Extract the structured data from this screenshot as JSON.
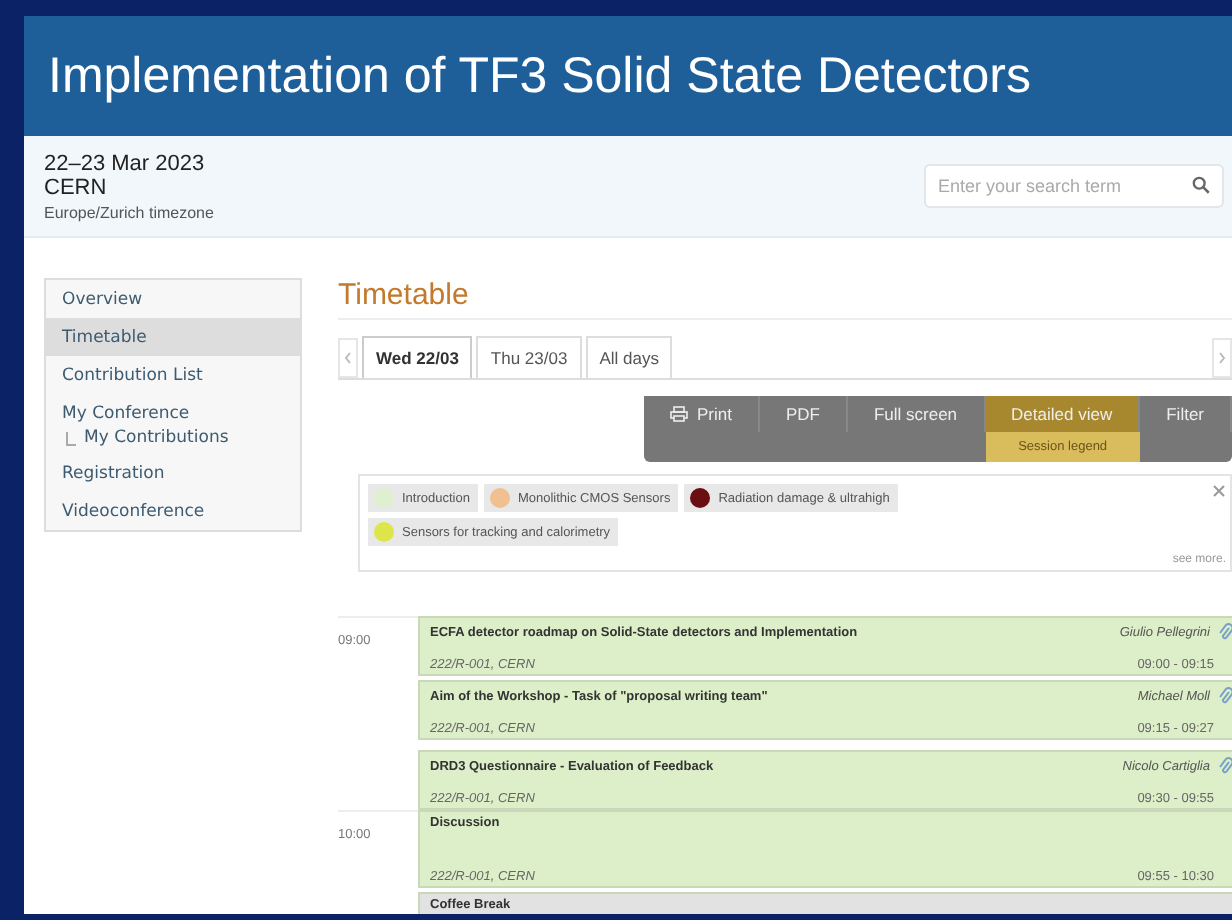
{
  "header": {
    "title": "Implementation of TF3 Solid State Detectors"
  },
  "event_info": {
    "dates": "22–23 Mar 2023",
    "venue": "CERN",
    "timezone": "Europe/Zurich timezone"
  },
  "search": {
    "placeholder": "Enter your search term"
  },
  "sidebar": {
    "items": [
      {
        "label": "Overview",
        "selected": false
      },
      {
        "label": "Timetable",
        "selected": true
      },
      {
        "label": "Contribution List",
        "selected": false
      },
      {
        "label": "My Conference",
        "selected": false,
        "children": [
          {
            "label": "My Contributions"
          }
        ]
      },
      {
        "label": "Registration",
        "selected": false
      },
      {
        "label": "Videoconference",
        "selected": false
      }
    ]
  },
  "page_title": "Timetable",
  "day_tabs": [
    {
      "label": "Wed 22/03",
      "selected": true
    },
    {
      "label": "Thu 23/03",
      "selected": false
    },
    {
      "label": "All days",
      "selected": false
    }
  ],
  "toolbar": [
    {
      "label": "Print",
      "kind": "print",
      "selected": false
    },
    {
      "label": "PDF",
      "kind": "plain",
      "selected": false
    },
    {
      "label": "Full screen",
      "kind": "plain",
      "selected": false
    },
    {
      "label": "Detailed view",
      "kind": "plain",
      "selected": true
    },
    {
      "label": "Filter",
      "kind": "plain",
      "selected": false
    }
  ],
  "dropdown_item": "Session legend",
  "legend": {
    "items": [
      {
        "label": "Introduction",
        "color": "#dff0d0"
      },
      {
        "label": "Monolithic CMOS Sensors",
        "color": "#f0c090"
      },
      {
        "label": "Radiation damage & ultrahigh",
        "color": "#6a0f12"
      },
      {
        "label": "Sensors for tracking and calorimetry",
        "color": "#dde54a"
      }
    ],
    "see_more": "see more."
  },
  "slots": [
    {
      "time": "09:00",
      "entries": [
        {
          "title": "ECFA detector roadmap on Solid-State detectors and Implementation",
          "speaker": "Giulio Pellegrini",
          "location": "222/R-001, CERN",
          "range": "09:00 - 09:15",
          "attachment": true,
          "color": "#dcefc8"
        },
        {
          "title": "Aim of the Workshop - Task of \"proposal writing team\"",
          "speaker": "Michael Moll",
          "location": "222/R-001, CERN",
          "range": "09:15 - 09:27",
          "attachment": true,
          "color": "#dcefc8"
        },
        {
          "title": "DRD3 Questionnaire - Evaluation of Feedback",
          "speaker": "Nicolo Cartiglia",
          "location": "222/R-001, CERN",
          "range": "09:30 - 09:55",
          "attachment": true,
          "color": "#dcefc8"
        }
      ]
    },
    {
      "time": "10:00",
      "entries": [
        {
          "title": "Discussion",
          "location": "222/R-001, CERN",
          "range": "09:55 - 10:30",
          "attachment": false,
          "color": "#dcefc8"
        },
        {
          "title": "Coffee Break",
          "color": "#e2e2e2"
        }
      ]
    }
  ]
}
